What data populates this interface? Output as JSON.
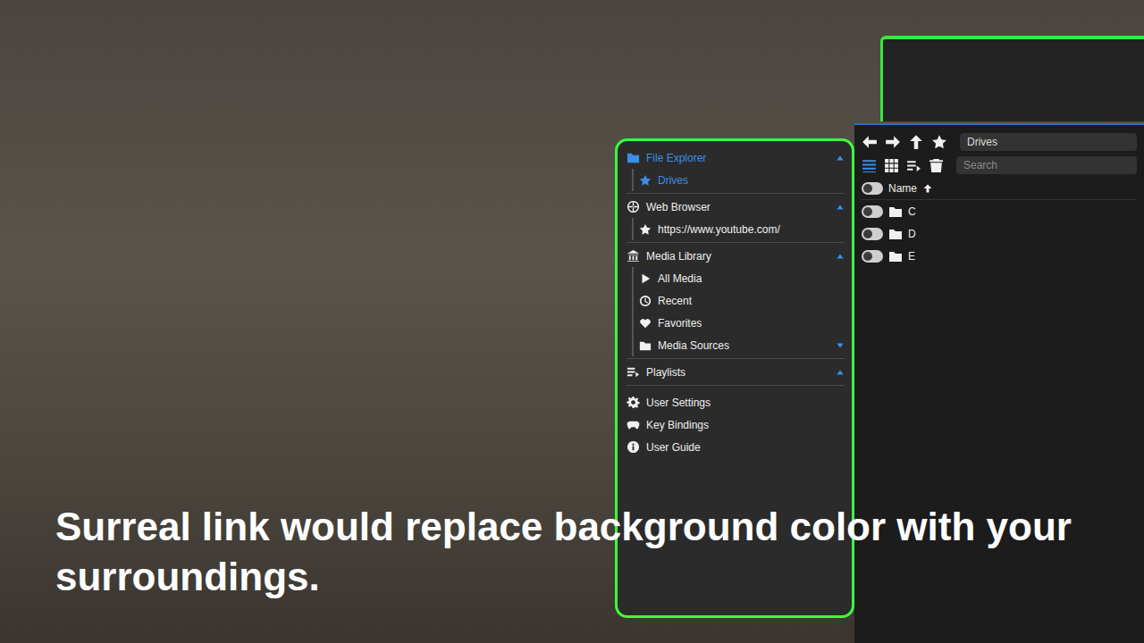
{
  "sidebar": {
    "sections": [
      {
        "title": "File Explorer",
        "expanded": true,
        "selected": true,
        "items": [
          {
            "label": "Drives",
            "selected": true,
            "expandable": false,
            "expanded": false
          }
        ]
      },
      {
        "title": "Web Browser",
        "expanded": true,
        "selected": false,
        "items": [
          {
            "label": "https://www.youtube.com/",
            "selected": false,
            "expandable": false,
            "expanded": false
          }
        ]
      },
      {
        "title": "Media Library",
        "expanded": true,
        "selected": false,
        "items": [
          {
            "label": "All Media",
            "selected": false,
            "expandable": false,
            "expanded": false
          },
          {
            "label": "Recent",
            "selected": false,
            "expandable": false,
            "expanded": false
          },
          {
            "label": "Favorites",
            "selected": false,
            "expandable": false,
            "expanded": false
          },
          {
            "label": "Media Sources",
            "selected": false,
            "expandable": true,
            "expanded": false
          }
        ]
      },
      {
        "title": "Playlists",
        "expanded": true,
        "selected": false,
        "items": []
      }
    ],
    "footer": [
      {
        "label": "User Settings"
      },
      {
        "label": "Key Bindings"
      },
      {
        "label": "User Guide"
      }
    ]
  },
  "toolbar": {
    "path": "Drives",
    "search_placeholder": "Search"
  },
  "list": {
    "column": {
      "label": "Name",
      "sort_ascending": true,
      "checked": false
    },
    "rows": [
      {
        "name": "C",
        "checked": false
      },
      {
        "name": "D",
        "checked": false
      },
      {
        "name": "E",
        "checked": false
      }
    ]
  },
  "caption": "Surreal link would replace background color with your surroundings."
}
